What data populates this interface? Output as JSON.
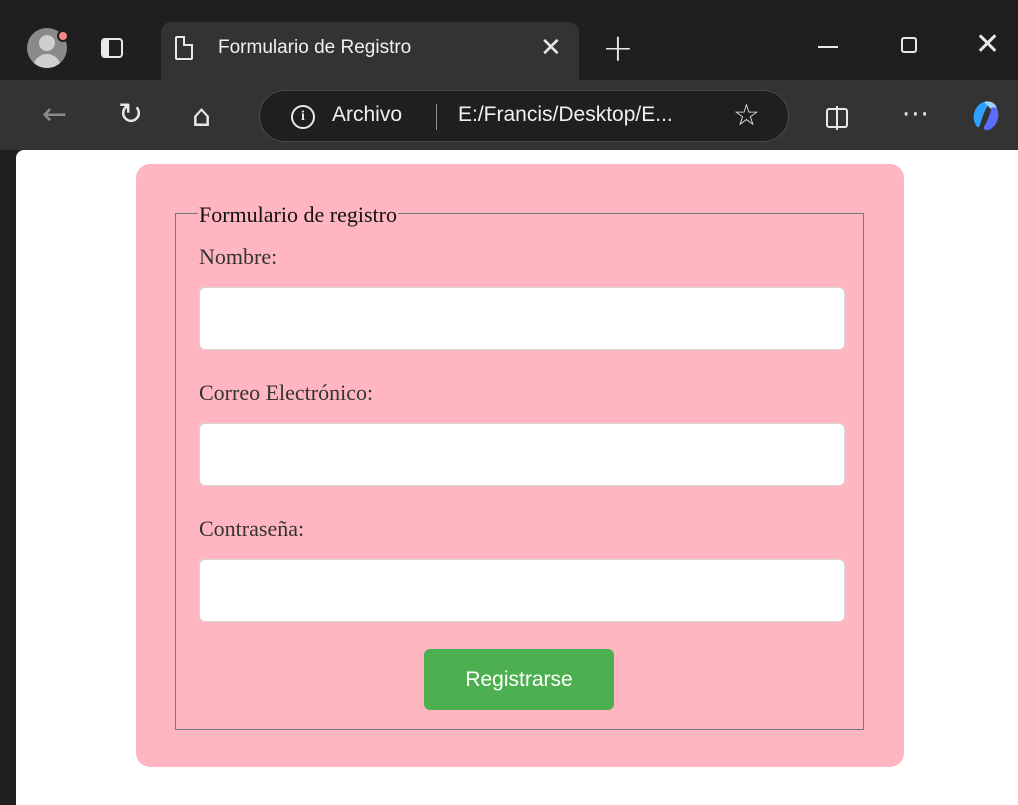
{
  "browser": {
    "tab_title": "Formulario de Registro",
    "tab_close": "✕",
    "new_tab": "+",
    "window_close": "✕",
    "nav": {
      "back": "←",
      "reload": "↻",
      "home": "⌂"
    },
    "address": {
      "info": "i",
      "site_chip": "Archivo",
      "url": "E:/Francis/Desktop/E...",
      "star": "☆"
    },
    "more": "···"
  },
  "form": {
    "legend": "Formulario de registro",
    "name_label": "Nombre:",
    "name_value": "",
    "email_label": "Correo Electrónico:",
    "email_value": "",
    "password_label": "Contraseña:",
    "password_value": "",
    "submit_label": "Registrarse"
  },
  "colors": {
    "form_background": "#ffb6c1",
    "submit_button": "#4caf50",
    "browser_chrome": "#1f1f1f",
    "toolbar": "#333333"
  }
}
